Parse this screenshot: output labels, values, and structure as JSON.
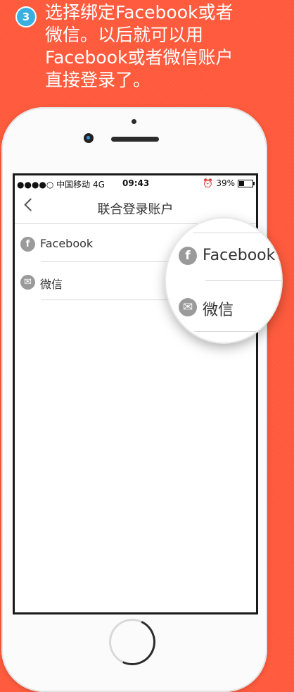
{
  "step": {
    "number": "3",
    "instruction": "选择绑定Facebook或者微信。以后就可以用Facebook或者微信账户直接登录了。"
  },
  "statusbar": {
    "carrier": "●●●●○ 中国移动  4G",
    "time": "09:43",
    "battery_percent": "39%",
    "alarm_icon": "⏰"
  },
  "navbar": {
    "title": "联合登录账户",
    "back_icon": "chevron-left-icon"
  },
  "accounts": [
    {
      "label": "Facebook",
      "icon": "facebook-icon",
      "glyph": "f"
    },
    {
      "label": "微信",
      "icon": "wechat-icon",
      "glyph": "✉"
    }
  ],
  "magnifier": {
    "items": [
      {
        "label": "Facebook",
        "glyph": "f"
      },
      {
        "label": "微信",
        "glyph": "✉"
      }
    ]
  },
  "colors": {
    "background": "#ff5a3c",
    "badge": "#39b0e0",
    "icon_gray": "#9a9a9a"
  }
}
